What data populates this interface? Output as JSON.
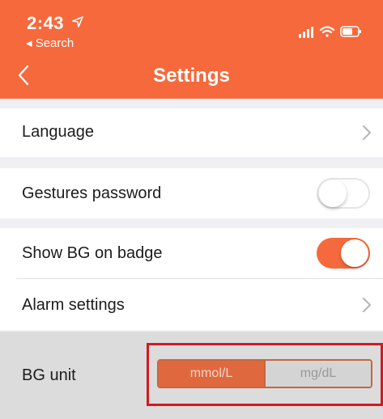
{
  "status_bar": {
    "time": "2:43",
    "back_app": "◂ Search"
  },
  "nav": {
    "title": "Settings"
  },
  "settings": {
    "language": "Language",
    "gestures_password": "Gestures password",
    "show_bg_on_badge": "Show BG on badge",
    "alarm_settings": "Alarm settings",
    "bg_unit": "BG unit"
  },
  "toggles": {
    "gestures_password": false,
    "show_bg_on_badge": true
  },
  "bg_unit_options": {
    "option1": "mmol/L",
    "option2": "mg/dL",
    "selected": "mmol/L"
  },
  "colors": {
    "accent": "#f5693c",
    "highlight_border": "#d11a24"
  }
}
